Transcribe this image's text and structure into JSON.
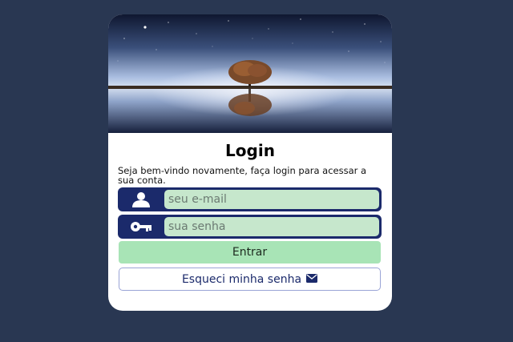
{
  "login": {
    "title": "Login",
    "subtitle": "Seja bem-vindo novamente, faça login para acessar a sua conta.",
    "email_placeholder": "seu e-mail",
    "password_placeholder": "sua senha",
    "submit_label": "Entrar",
    "forgot_label": "Esqueci minha senha"
  },
  "icons": {
    "email_field": "user-icon",
    "password_field": "key-icon",
    "forgot_button": "envelope-icon"
  },
  "colors": {
    "background": "#293752",
    "field_dark": "#1b2a6b",
    "input_fill": "#c6e7cc",
    "submit_fill": "#a8e4b6"
  }
}
